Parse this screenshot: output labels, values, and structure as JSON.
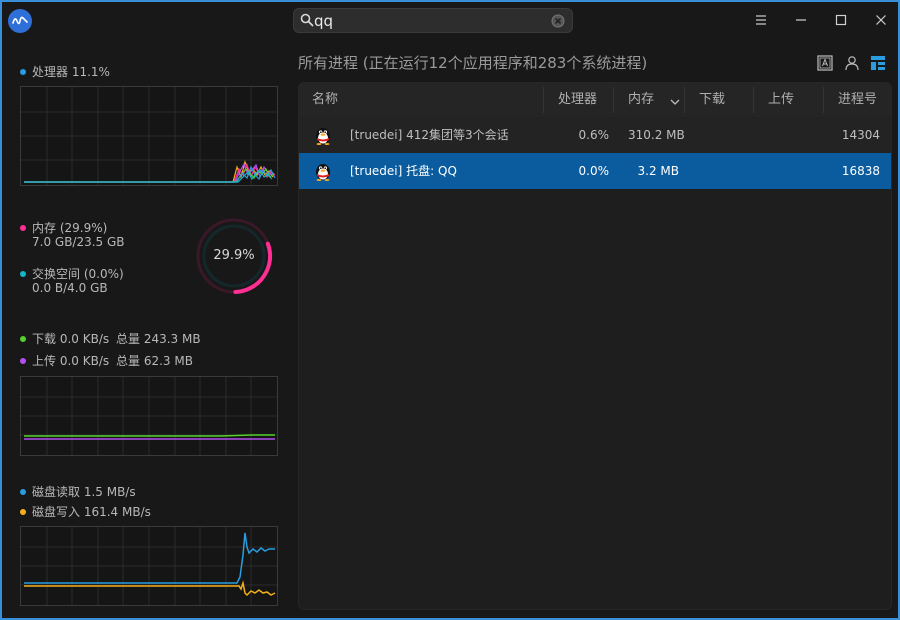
{
  "search": {
    "value": "qq"
  },
  "left": {
    "cpu": {
      "label": "处理器 11.1%",
      "color": "#2a9de0"
    },
    "memory": {
      "label": "内存 (29.9%)",
      "detail": "7.0 GB/23.5 GB",
      "color": "#ff2e93"
    },
    "swap": {
      "label": "交换空间 (0.0%)",
      "detail": "0.0 B/4.0 GB",
      "color": "#13b6c9"
    },
    "ring_value": "29.9%",
    "ring_fraction": 0.299,
    "download": {
      "label": "下载 0.0 KB/s",
      "total": "总量 243.3 MB",
      "color": "#56d12c"
    },
    "upload": {
      "label": "上传 0.0 KB/s",
      "total": "总量 62.3 MB",
      "color": "#b24ff0"
    },
    "disk_read": {
      "label": "磁盘读取 1.5 MB/s",
      "color": "#2a9de0"
    },
    "disk_write": {
      "label": "磁盘写入 161.4 MB/s",
      "color": "#f3b01a"
    }
  },
  "main": {
    "heading": "所有进程 (正在运行12个应用程序和283个系统进程)",
    "columns": {
      "name": "名称",
      "cpu": "处理器",
      "mem": "内存",
      "down": "下载",
      "up": "上传",
      "pid": "进程号"
    },
    "rows": [
      {
        "name": "[truedei] 412集团等3个会话",
        "cpu": "0.6%",
        "mem": "310.2 MB",
        "down": "",
        "up": "",
        "pid": "14304"
      },
      {
        "name": "[truedei] 托盘: QQ",
        "cpu": "0.0%",
        "mem": "3.2 MB",
        "down": "",
        "up": "",
        "pid": "16838"
      }
    ]
  },
  "icons": {
    "app_logo": "waveform-logo-icon",
    "search": "search-icon",
    "clear": "clear-icon",
    "menu": "menu-icon",
    "minimize": "minimize-icon",
    "maximize": "maximize-icon",
    "close": "close-icon",
    "sort": "chevron-down-icon",
    "qq": "qq-penguin-icon"
  }
}
